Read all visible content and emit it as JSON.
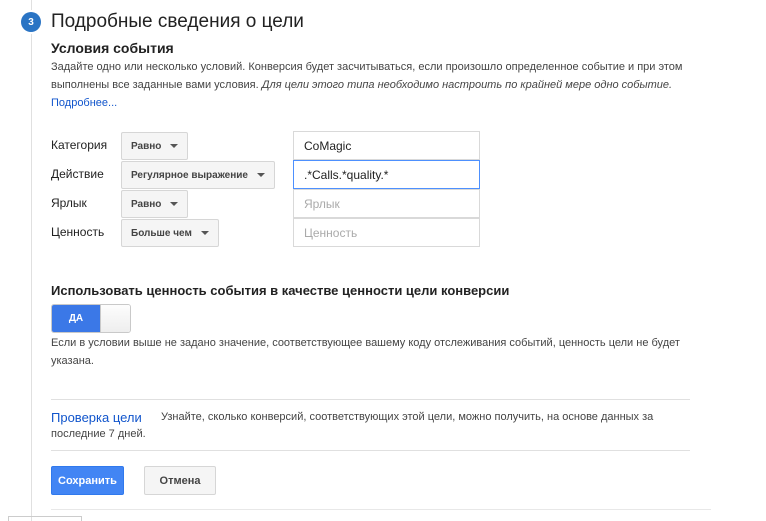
{
  "step": {
    "number": "3",
    "title": "Подробные сведения о цели"
  },
  "conditions": {
    "title": "Условия события",
    "desc_plain": "Задайте одно или несколько условий. Конверсия будет засчитываться, если произошло определенное событие и при этом выполнены все заданные вами условия. ",
    "desc_italic": "Для цели этого типа необходимо настроить по крайней мере одно событие.",
    "more_link": "Подробнее..."
  },
  "rows": [
    {
      "label": "Категория",
      "operator": "Равно",
      "value": "CoMagic",
      "placeholder": ""
    },
    {
      "label": "Действие",
      "operator": "Регулярное выражение",
      "value": ".*Calls.*quality.*",
      "placeholder": ""
    },
    {
      "label": "Ярлык",
      "operator": "Равно",
      "value": "",
      "placeholder": "Ярлык"
    },
    {
      "label": "Ценность",
      "operator": "Больше чем",
      "value": "",
      "placeholder": "Ценность"
    }
  ],
  "use_value": {
    "title": "Использовать ценность события в качестве ценности цели конверсии",
    "toggle_label": "ДА",
    "toggle_on": true,
    "note": "Если в условии выше не задано значение, соответствующее вашему коду отслеживания событий, ценность цели не будет указана."
  },
  "verify": {
    "link": "Проверка цели",
    "text_line1": "Узнайте, сколько конверсий, соответствующих этой цели, можно получить, на основе данных за",
    "text_line2": "последние 7 дней."
  },
  "buttons": {
    "save": "Сохранить",
    "cancel": "Отмена"
  },
  "colors": {
    "accent": "#4285f4",
    "link": "#1155cc",
    "step_badge": "#2a74c4"
  }
}
